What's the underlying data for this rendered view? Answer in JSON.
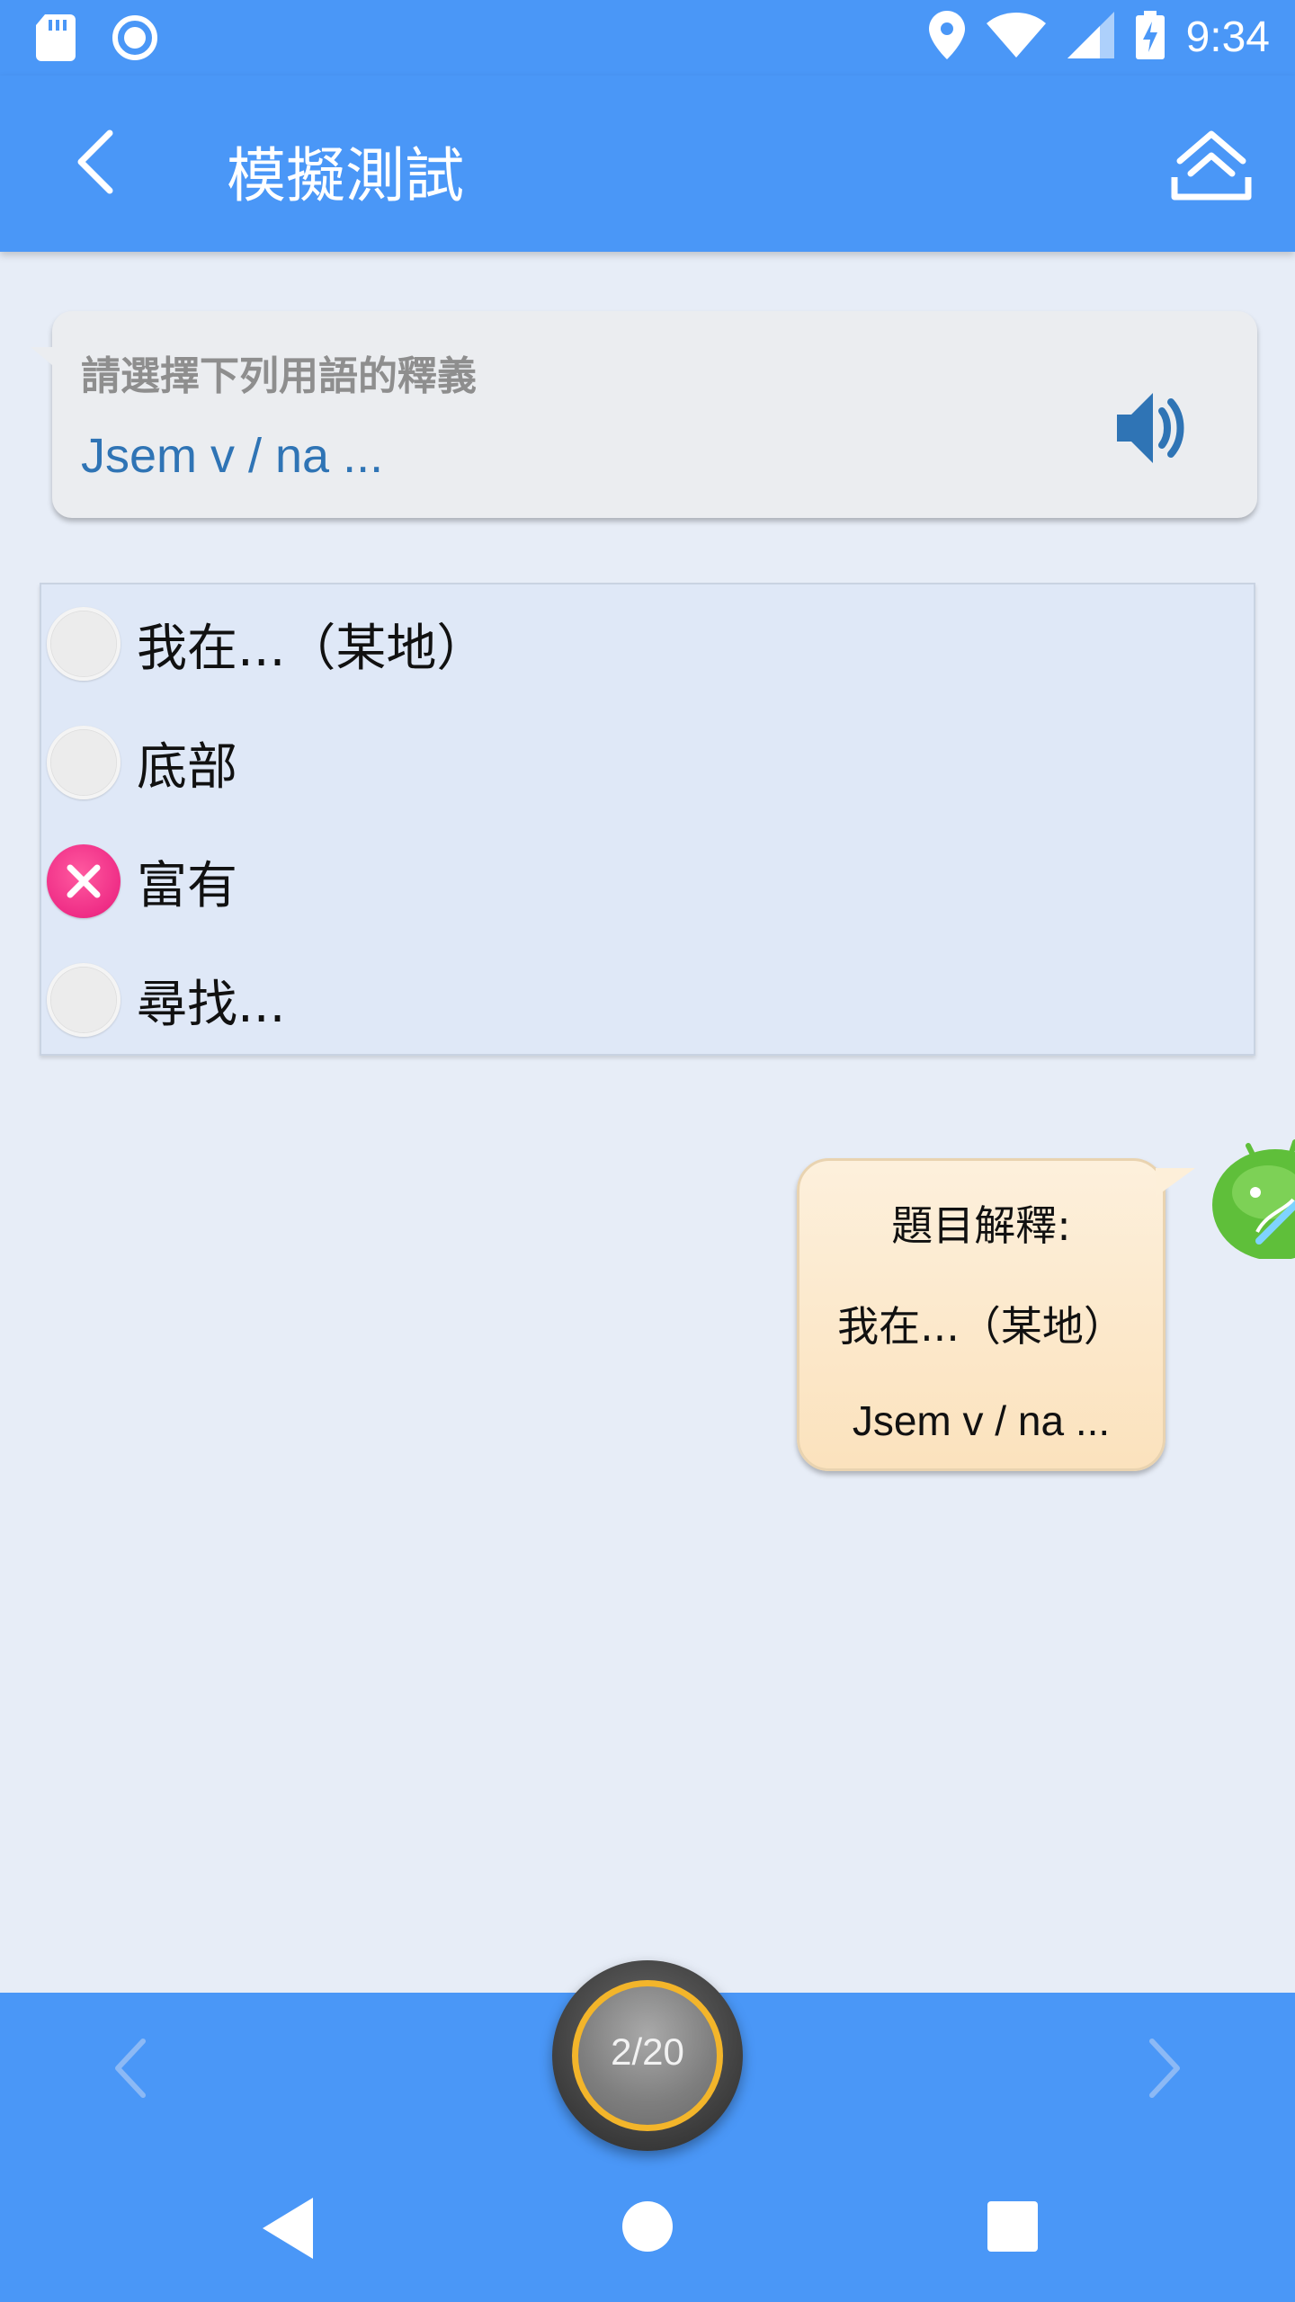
{
  "status_bar": {
    "time": "9:34",
    "icons": [
      "sd-card-icon",
      "sync-icon",
      "location-icon",
      "wifi-icon",
      "signal-icon",
      "battery-charging-icon"
    ]
  },
  "app_bar": {
    "title": "模擬測試",
    "back_icon": "chevron-left-icon",
    "share_icon": "share-upload-icon"
  },
  "question": {
    "prompt": "請選擇下列用語的釋義",
    "term": "Jsem v / na ...",
    "audio_icon": "speaker-icon"
  },
  "options": [
    {
      "label": "我在...（某地）",
      "state": "unselected"
    },
    {
      "label": "底部",
      "state": "unselected"
    },
    {
      "label": "富有",
      "state": "wrong"
    },
    {
      "label": "尋找...",
      "state": "unselected"
    }
  ],
  "explanation": {
    "title": "題目解釋:",
    "meaning": "我在...（某地）",
    "term": "Jsem v / na ..."
  },
  "progress": {
    "text": "2/20",
    "current": 2,
    "total": 20
  },
  "bottom_nav": {
    "prev_icon": "chevron-left-icon",
    "next_icon": "chevron-right-icon"
  },
  "colors": {
    "primary": "#4a97f7",
    "background": "#e7edf7",
    "wrong": "#ef2d86",
    "term_text": "#2f74b5",
    "explanation_bg": "#fbe2bd"
  }
}
